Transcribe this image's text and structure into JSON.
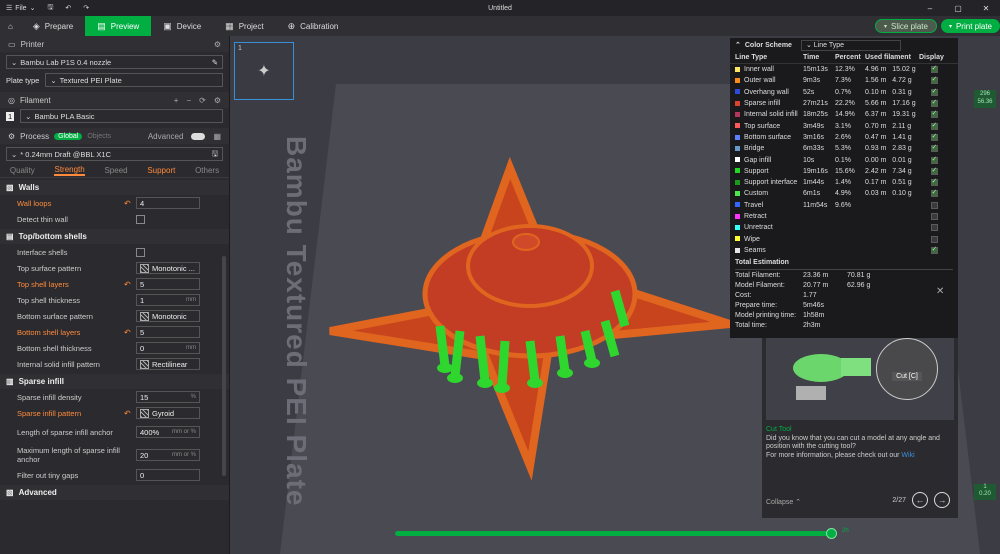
{
  "titlebar": {
    "file_label": "File",
    "title": "Untitled"
  },
  "toolbar": {
    "tabs": [
      {
        "label": "Prepare"
      },
      {
        "label": "Preview"
      },
      {
        "label": "Device"
      },
      {
        "label": "Project"
      },
      {
        "label": "Calibration"
      }
    ],
    "slice_label": "Slice plate",
    "print_label": "Print plate"
  },
  "printer": {
    "section_label": "Printer",
    "name": "Bambu Lab P1S 0.4 nozzle",
    "plate_type_label": "Plate type",
    "plate_type_value": "Textured PEI Plate"
  },
  "filament": {
    "section_label": "Filament",
    "slot_number": "1",
    "name": "Bambu PLA Basic"
  },
  "process": {
    "section_label": "Process",
    "global_label": "Global",
    "objects_label": "Objects",
    "advanced_label": "Advanced",
    "profile": "* 0.24mm Draft @BBL X1C",
    "tabs": [
      "Quality",
      "Strength",
      "Speed",
      "Support",
      "Others"
    ]
  },
  "groups": {
    "walls": "Walls",
    "topbottom": "Top/bottom shells",
    "infill": "Sparse infill",
    "advanced": "Advanced"
  },
  "params": {
    "wall_loops": {
      "label": "Wall loops",
      "value": "4"
    },
    "detect_thin": {
      "label": "Detect thin wall"
    },
    "interface_shells": {
      "label": "Interface shells"
    },
    "top_pattern": {
      "label": "Top surface pattern",
      "value": "Monotonic ..."
    },
    "top_layers": {
      "label": "Top shell layers",
      "value": "5"
    },
    "top_thickness": {
      "label": "Top shell thickness",
      "value": "1",
      "unit": "mm"
    },
    "bottom_pattern": {
      "label": "Bottom surface pattern",
      "value": "Monotonic"
    },
    "bottom_layers": {
      "label": "Bottom shell layers",
      "value": "5"
    },
    "bottom_thickness": {
      "label": "Bottom shell thickness",
      "value": "0",
      "unit": "mm"
    },
    "internal_pattern": {
      "label": "Internal solid infill pattern",
      "value": "Rectilinear"
    },
    "infill_density": {
      "label": "Sparse infill density",
      "value": "15",
      "unit": "%"
    },
    "infill_pattern": {
      "label": "Sparse infill pattern",
      "value": "Gyroid"
    },
    "infill_anchor": {
      "label": "Length of sparse infill anchor",
      "value": "400%",
      "unit": "mm or %"
    },
    "infill_anchor_max": {
      "label": "Maximum length of sparse infill anchor",
      "value": "20",
      "unit": "mm or %"
    },
    "filter_gaps": {
      "label": "Filter out tiny gaps",
      "value": "0"
    }
  },
  "plate": {
    "label": "Bambu Textured PEI Plate",
    "thumb_number": "1"
  },
  "color_scheme": {
    "label": "Color Scheme",
    "mode": "Line Type",
    "headers": [
      "Line Type",
      "Time",
      "Percent",
      "Used filament",
      "Display"
    ],
    "rows": [
      {
        "name": "Inner wall",
        "color": "#ffe566",
        "time": "15m13s",
        "percent": "12.3%",
        "used": "4.96 m   15.02 g",
        "display": true
      },
      {
        "name": "Outer wall",
        "color": "#ff8c1a",
        "time": "9m3s",
        "percent": "7.3%",
        "used": "1.56 m   4.72 g",
        "display": true
      },
      {
        "name": "Overhang wall",
        "color": "#2e4cd9",
        "time": "52s",
        "percent": "0.7%",
        "used": "0.10 m   0.31 g",
        "display": true
      },
      {
        "name": "Sparse infill",
        "color": "#d9442e",
        "time": "27m21s",
        "percent": "22.2%",
        "used": "5.66 m   17.16 g",
        "display": true
      },
      {
        "name": "Internal solid infill",
        "color": "#b3365c",
        "time": "18m25s",
        "percent": "14.9%",
        "used": "6.37 m   19.31 g",
        "display": true
      },
      {
        "name": "Top surface",
        "color": "#ff5a5a",
        "time": "3m49s",
        "percent": "3.1%",
        "used": "0.70 m   2.11 g",
        "display": true
      },
      {
        "name": "Bottom surface",
        "color": "#5a80ff",
        "time": "3m16s",
        "percent": "2.6%",
        "used": "0.47 m   1.41 g",
        "display": true
      },
      {
        "name": "Bridge",
        "color": "#6699cc",
        "time": "6m33s",
        "percent": "5.3%",
        "used": "0.93 m   2.83 g",
        "display": true
      },
      {
        "name": "Gap infill",
        "color": "#ffffff",
        "time": "10s",
        "percent": "0.1%",
        "used": "0.00 m   0.01 g",
        "display": true
      },
      {
        "name": "Support",
        "color": "#22d922",
        "time": "19m16s",
        "percent": "15.6%",
        "used": "2.42 m   7.34 g",
        "display": true
      },
      {
        "name": "Support interface",
        "color": "#1a9a1a",
        "time": "1m44s",
        "percent": "1.4%",
        "used": "0.17 m   0.51 g",
        "display": true
      },
      {
        "name": "Custom",
        "color": "#4de64d",
        "time": "6m1s",
        "percent": "4.9%",
        "used": "0.03 m   0.10 g",
        "display": true
      },
      {
        "name": "Travel",
        "color": "#3366ff",
        "time": "11m54s",
        "percent": "9.6%",
        "used": "",
        "display": false
      },
      {
        "name": "Retract",
        "color": "#ff33ff",
        "time": "",
        "percent": "",
        "used": "",
        "display": false
      },
      {
        "name": "Unretract",
        "color": "#33ffff",
        "time": "",
        "percent": "",
        "used": "",
        "display": false
      },
      {
        "name": "Wipe",
        "color": "#ffff33",
        "time": "",
        "percent": "",
        "used": "",
        "display": false
      },
      {
        "name": "Seams",
        "color": "#e6e6e6",
        "time": "",
        "percent": "",
        "used": "",
        "display": true
      }
    ]
  },
  "estimation": {
    "label": "Total Estimation",
    "rows": [
      {
        "k": "Total Filament:",
        "a": "23.36 m",
        "b": "70.81 g"
      },
      {
        "k": "Model Filament:",
        "a": "20.77 m",
        "b": "62.96 g"
      },
      {
        "k": "Cost:",
        "a": "1.77",
        "b": ""
      },
      {
        "k": "Prepare time:",
        "a": "5m46s",
        "b": ""
      },
      {
        "k": "Model printing time:",
        "a": "1h58m",
        "b": ""
      },
      {
        "k": "Total time:",
        "a": "2h3m",
        "b": ""
      }
    ]
  },
  "tip": {
    "cut_label": "Cut [C]",
    "title": "Cut Tool",
    "body": "Did you know that you can cut a model at any angle and position with the cutting tool?",
    "more": "For more information, please check out our",
    "wiki": "Wiki",
    "collapse": "Collapse",
    "page": "2/27"
  },
  "layers": {
    "top_line1": "296",
    "top_line2": "56.36",
    "bottom_line1": "1",
    "bottom_line2": "0.20",
    "h_value": "2h"
  }
}
